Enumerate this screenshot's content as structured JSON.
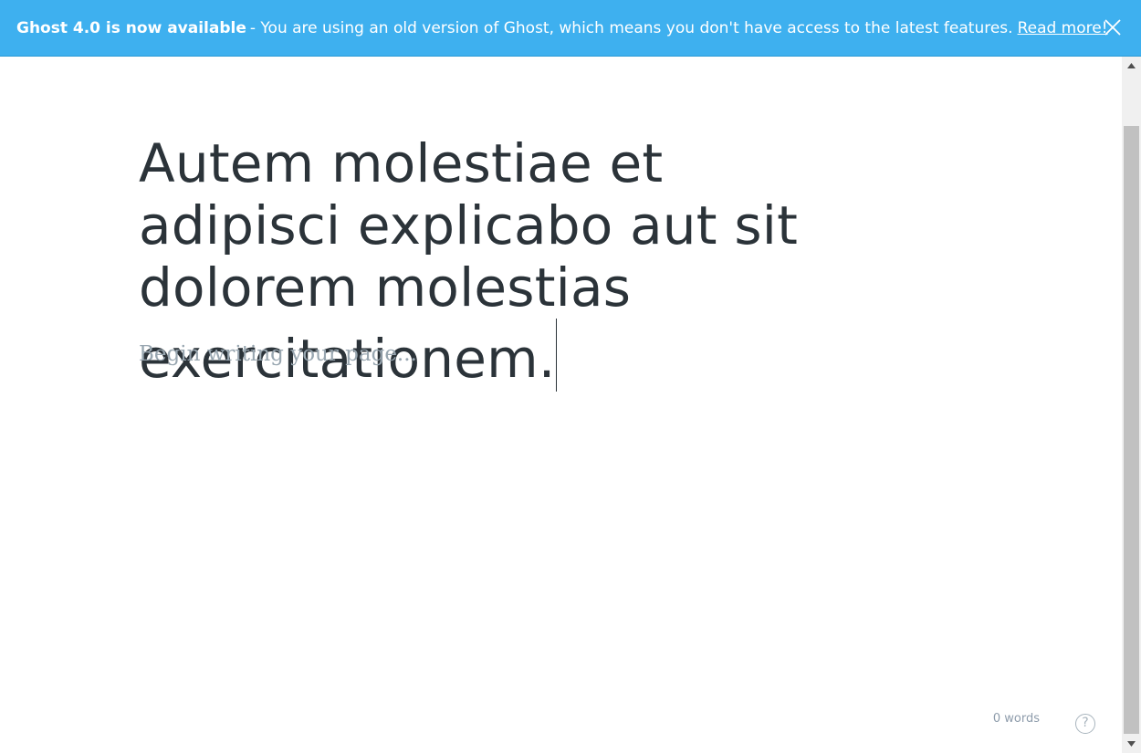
{
  "banner": {
    "headline": "Ghost 4.0 is now available",
    "message": "- You are using an old version of Ghost, which means you don't have access to the latest features.",
    "link_label": "Read more!",
    "close_icon": "close-icon"
  },
  "editor": {
    "title": "Autem molestiae et adipisci explicabo aut sit dolorem molestias exercitationem.",
    "body_placeholder": "Begin writing your page..."
  },
  "footer": {
    "word_count": "0 words",
    "help_label": "?"
  },
  "colors": {
    "banner_bg": "#3eb0ef",
    "title_text": "#2b3339",
    "placeholder_text": "#98a6b0"
  }
}
